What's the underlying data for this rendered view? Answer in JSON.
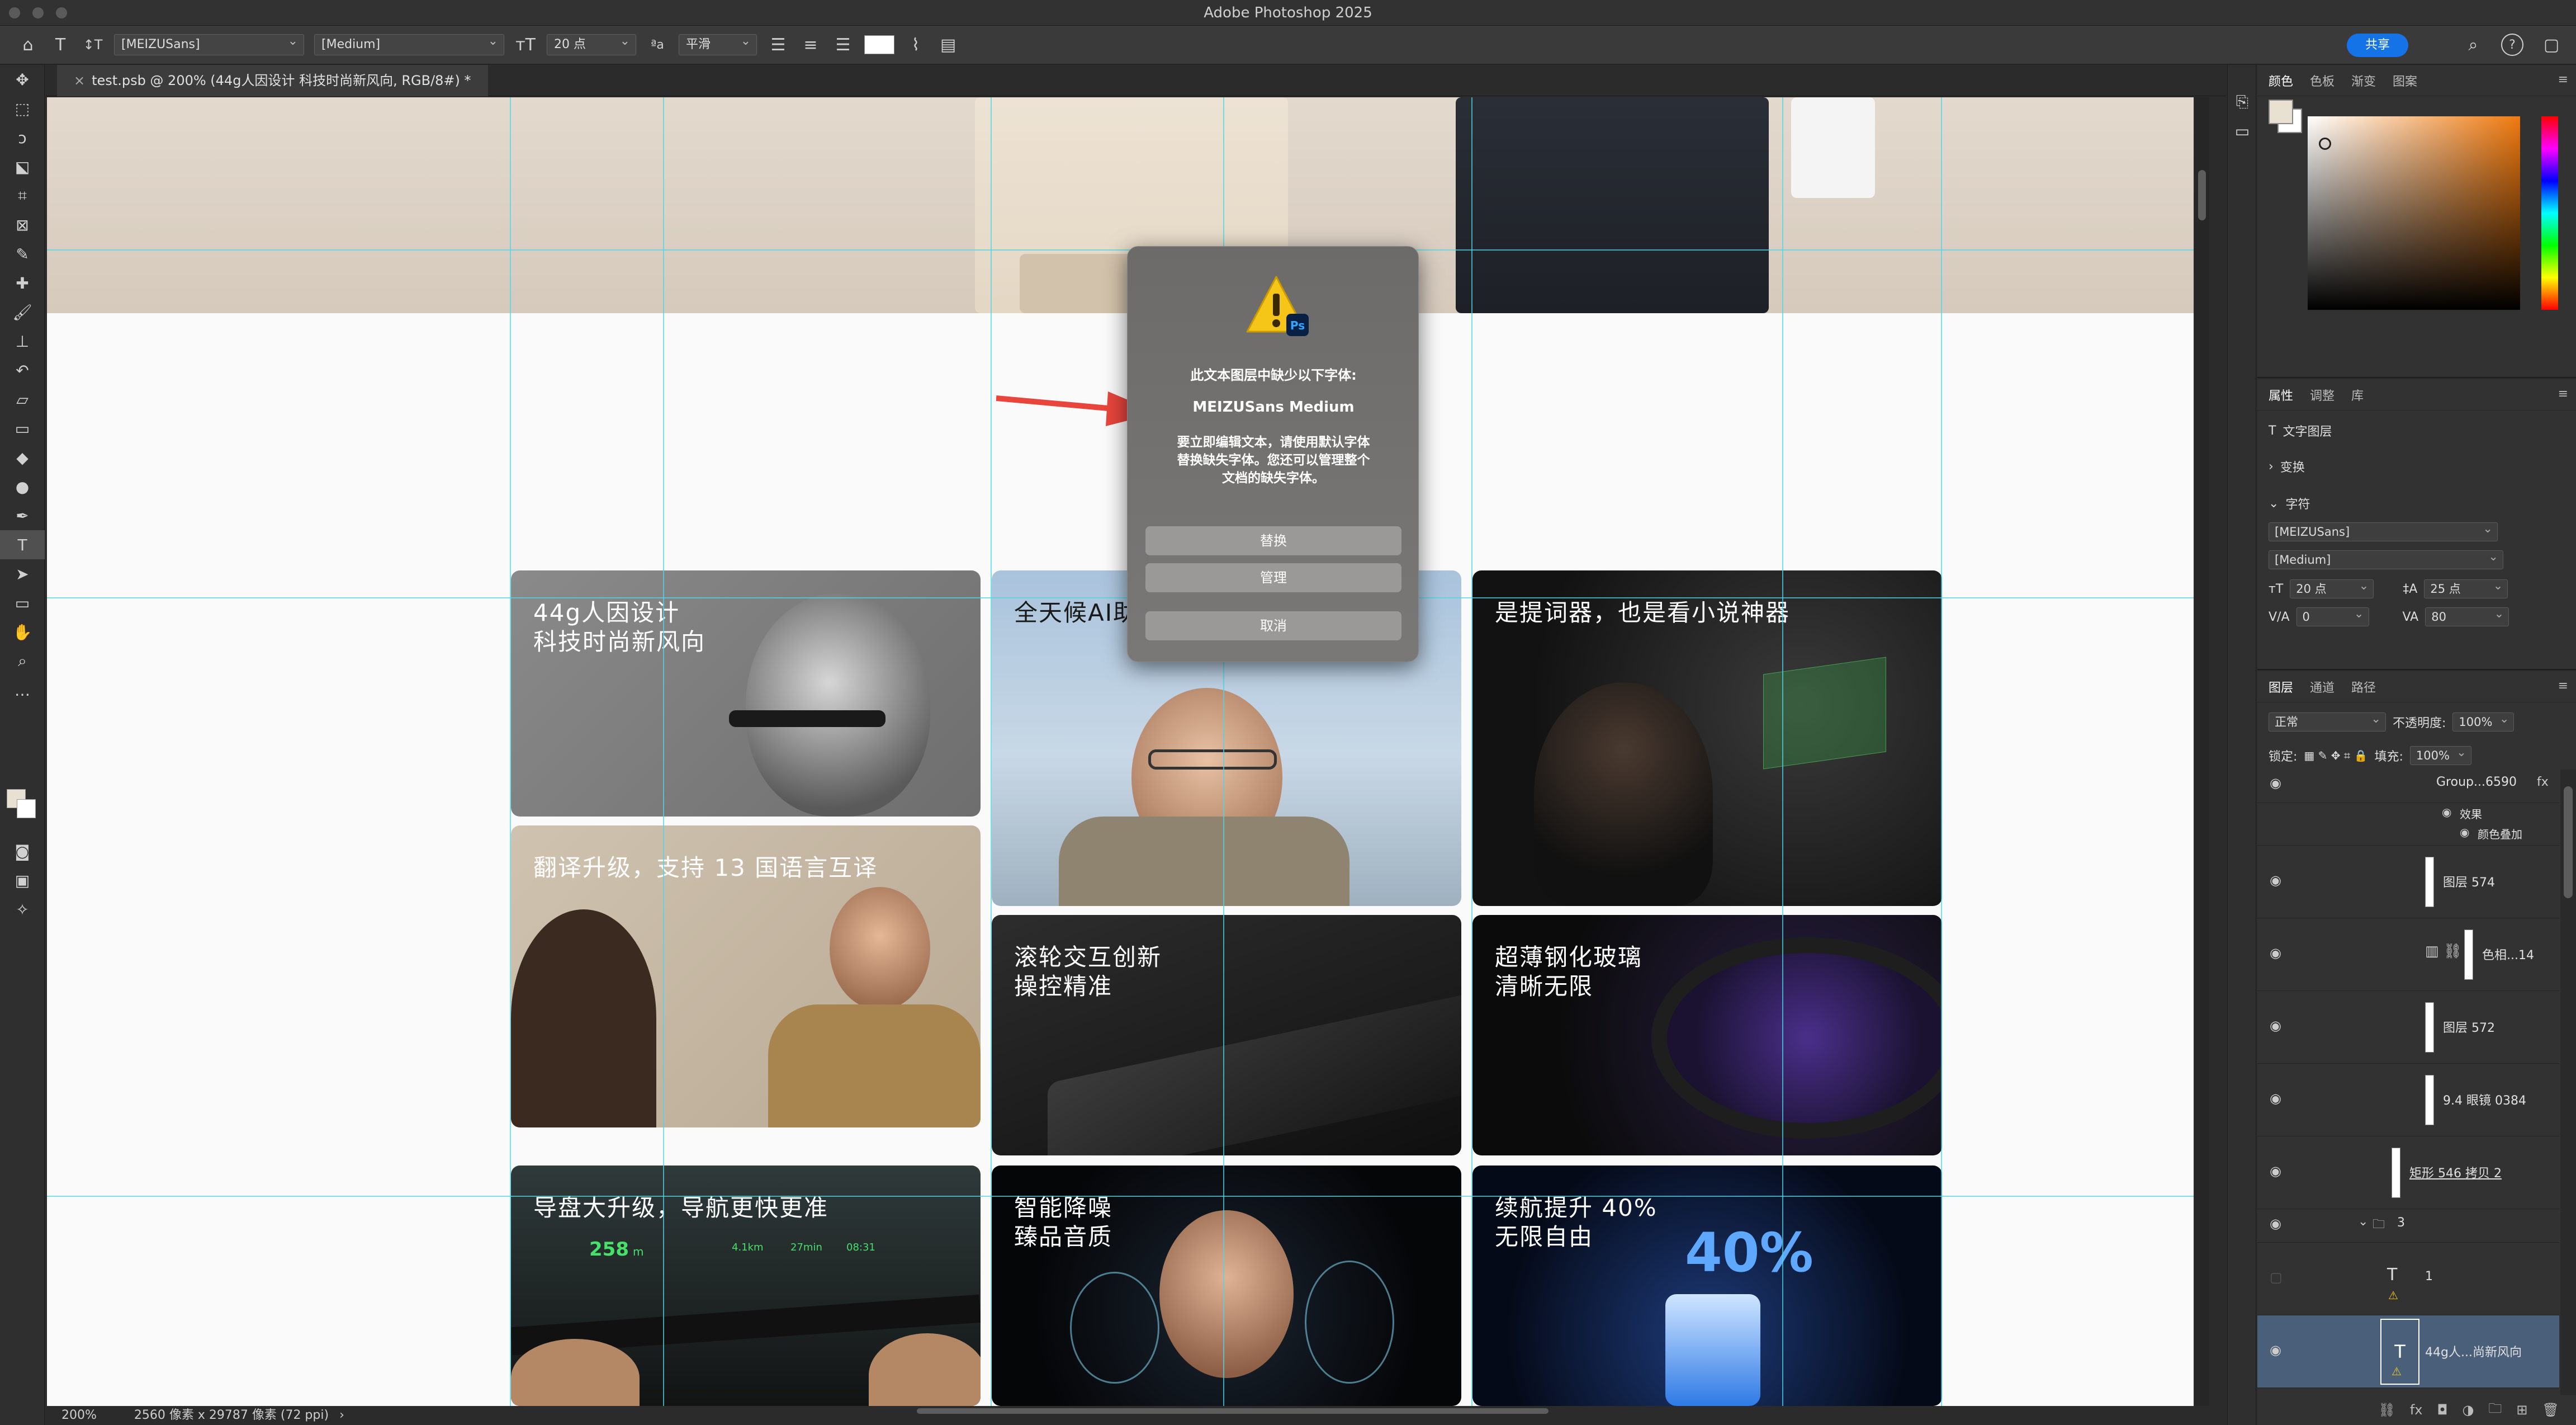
{
  "window": {
    "title": "Adobe Photoshop 2025"
  },
  "options_bar": {
    "font_family": "[MEIZUSans]",
    "font_style": "[Medium]",
    "font_size": "20 点",
    "antialias": "平滑",
    "share_label": "共享",
    "icons": [
      "home-icon",
      "text-tool-icon",
      "text-orientation-icon",
      "font-size-icon",
      "antialias-icon",
      "align-left-icon",
      "align-center-icon",
      "align-right-icon",
      "text-color-swatch",
      "warp-text-icon",
      "character-panel-icon",
      "search-icon",
      "help-icon",
      "workspace-icon"
    ]
  },
  "document": {
    "tab_title": "test.psb @ 200% (44g人因设计 科技时尚新风向, RGB/8#) *",
    "status_zoom": "200%",
    "status_info": "2560 像素 x 29787 像素 (72 ppi)"
  },
  "cards": [
    {
      "title": "44g人因设计\n科技时尚新风向"
    },
    {
      "title": "全天候AI助"
    },
    {
      "title": "是提词器，也是看小说神器"
    },
    {
      "title": "翻译升级，支持 13 国语言互译"
    },
    {
      "title": "滚轮交互创新\n操控精准"
    },
    {
      "title": "超薄钢化玻璃\n清晰无限"
    },
    {
      "title": "导盘大升级，导航更快更准"
    },
    {
      "title": "智能降噪\n臻品音质"
    },
    {
      "title": "续航提升 40%\n无限自由"
    }
  ],
  "card_overlays": {
    "nav_distance": "258",
    "nav_unit": "m",
    "nav_stat1": "4.1km",
    "nav_stat2": "27min",
    "nav_stat3": "08:31",
    "battery_percent": "40%"
  },
  "dialog": {
    "title": "此文本图层中缺少以下字体:",
    "missing_font": "MEIZUSans Medium",
    "message": "要立即编辑文本，请使用默认字体替换缺失字体。您还可以管理整个文档的缺失字体。",
    "buttons": {
      "replace": "替换",
      "manage": "管理",
      "cancel": "取消"
    }
  },
  "color_panel": {
    "tabs": [
      "颜色",
      "色板",
      "渐变",
      "图案"
    ]
  },
  "properties_panel": {
    "tabs": [
      "属性",
      "调整",
      "库"
    ],
    "layer_kind": "文字图层",
    "transform_label": "变换",
    "character_label": "字符",
    "font_family": "[MEIZUSans]",
    "font_style": "[Medium]",
    "font_size": "20 点",
    "leading": "25 点",
    "kerning": "0",
    "tracking": "80"
  },
  "layers_panel": {
    "tabs": [
      "图层",
      "通道",
      "路径"
    ],
    "blend_mode": "正常",
    "opacity_label": "不透明度:",
    "opacity": "100%",
    "lock_label": "锁定:",
    "fill_label": "填充:",
    "fill": "100%",
    "layers": [
      {
        "name": "Group...6590",
        "extra": "fx"
      },
      {
        "name": "效果"
      },
      {
        "name": "颜色叠加"
      },
      {
        "name": "图层 574"
      },
      {
        "name": "色相...14"
      },
      {
        "name": "图层 572"
      },
      {
        "name": "9.4 眼镜 0384"
      },
      {
        "name": "矩形 546 拷贝 2"
      },
      {
        "name": "3"
      },
      {
        "name": "1"
      },
      {
        "name": "44g人...尚新风向"
      }
    ]
  },
  "colors": {
    "accent": "#1473e6",
    "guide": "#4fd6e6",
    "dialog_bg": "#737170"
  }
}
